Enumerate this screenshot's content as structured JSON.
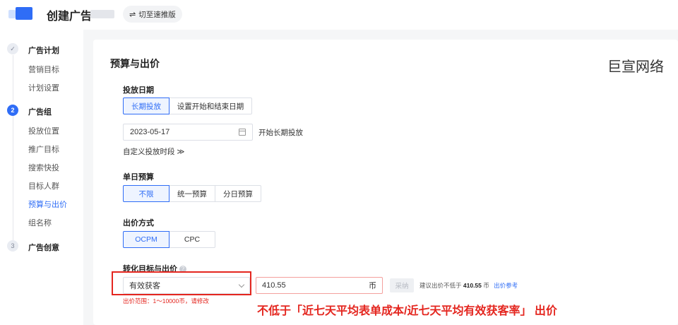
{
  "header": {
    "title": "创建广告",
    "switch_label": "切至速推版",
    "switch_icon": "swap-icon"
  },
  "sidebar": {
    "steps": [
      {
        "number": "✓",
        "title": "广告计划",
        "status": "done",
        "items": [
          "营销目标",
          "计划设置"
        ]
      },
      {
        "number": "2",
        "title": "广告组",
        "status": "active",
        "items": [
          "投放位置",
          "推广目标",
          "搜索快投",
          "目标人群",
          "预算与出价",
          "组名称"
        ]
      },
      {
        "number": "3",
        "title": "广告创意",
        "status": "todo",
        "items": []
      }
    ],
    "active_item": "预算与出价"
  },
  "main": {
    "section_title": "预算与出价",
    "watermark": "巨宣网络",
    "schedule": {
      "label": "投放日期",
      "options": [
        "长期投放",
        "设置开始和结束日期"
      ],
      "selected": "长期投放",
      "date_value": "2023-05-17",
      "date_hint": "开始长期投放",
      "custom_time_label": "自定义投放时段 ≫"
    },
    "budget": {
      "label": "单日预算",
      "options": [
        "不限",
        "统一预算",
        "分日预算"
      ],
      "selected": "不限"
    },
    "bid_method": {
      "label": "出价方式",
      "options": [
        "OCPM",
        "CPC"
      ],
      "selected": "OCPM"
    },
    "conversion": {
      "label": "转化目标与出价",
      "help_icon": "question-circle-icon",
      "target_value": "有效获客",
      "price_value": "410.55",
      "price_unit": "币",
      "adopt_label": "采纳",
      "suggest_prefix": "建议出价不低于",
      "suggest_value": "410.55",
      "suggest_unit": "币",
      "suggest_link": "出价参考",
      "error_text": "出价范围：1～10000币，请修改"
    },
    "annotation": "不低于「近七天平均表单成本/近七天平均有效获客率」 出价"
  },
  "colors": {
    "accent": "#2f6df6",
    "error": "#e4261f",
    "background": "#f5f6f7"
  }
}
